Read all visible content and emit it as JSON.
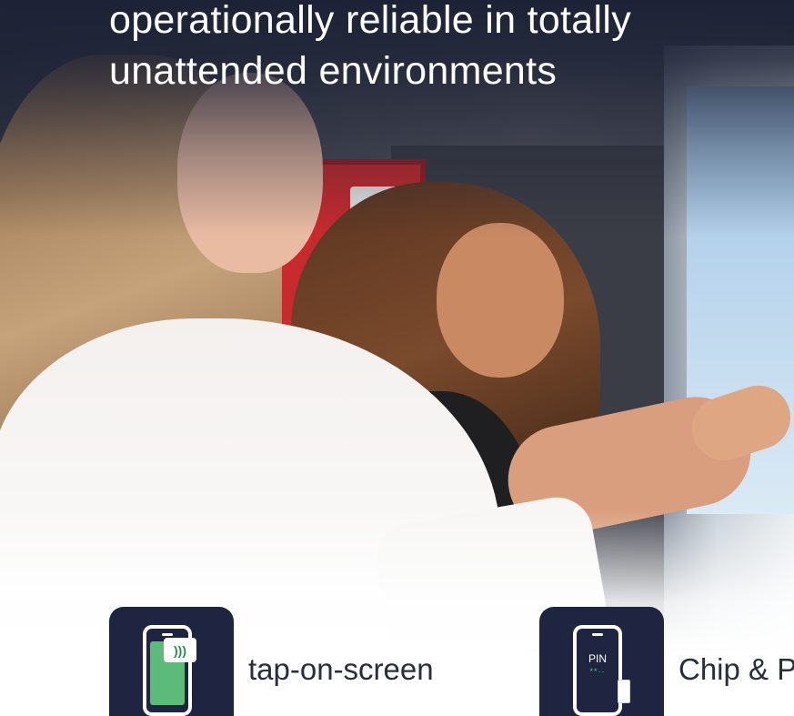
{
  "headline": {
    "line1": "operationally reliable in totally",
    "line2": "unattended environments"
  },
  "features": [
    {
      "label": "tap-on-screen",
      "icon": "phone-nfc-icon"
    },
    {
      "label": "Chip & PI",
      "icon": "phone-pin-icon",
      "pin_text": "PIN",
      "pin_stars": "**··"
    }
  ],
  "colors": {
    "headline_bg": "#1d2236",
    "icon_tile": "#1f2440",
    "accent_green": "#5dbb7a",
    "label_text": "#2a2d3a"
  }
}
